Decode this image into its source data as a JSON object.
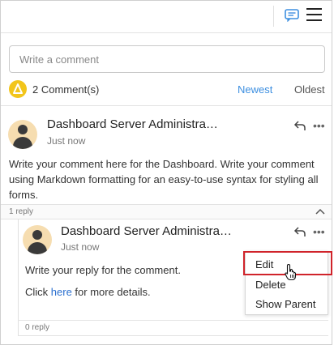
{
  "toolbar": {
    "comments_icon": "comment-icon",
    "menu_icon": "hamburger-menu-icon"
  },
  "composer": {
    "placeholder": "Write a comment"
  },
  "summary": {
    "count_label": "2 Comment(s)",
    "sort_newest": "Newest",
    "sort_oldest": "Oldest"
  },
  "comment": {
    "author": "Dashboard Server Administra…",
    "time": "Just now",
    "text": "Write your comment here for the Dashboard. Write your comment using Markdown formatting for an easy-to-use syntax for styling all forms.",
    "reply_count": "1 reply"
  },
  "reply": {
    "author": "Dashboard Server Administra…",
    "time": "Just now",
    "text": "Write your reply for the comment.",
    "details_prefix": "Click ",
    "details_link": "here",
    "details_suffix": " for more details.",
    "reply_count": "0 reply"
  },
  "context_menu": {
    "items": [
      "Edit",
      "Delete",
      "Show Parent"
    ]
  },
  "colors": {
    "accent": "#3d8fe0",
    "badge": "#f2c51b",
    "highlight": "#d0232a",
    "avatar_bg": "#f6ddb0"
  }
}
